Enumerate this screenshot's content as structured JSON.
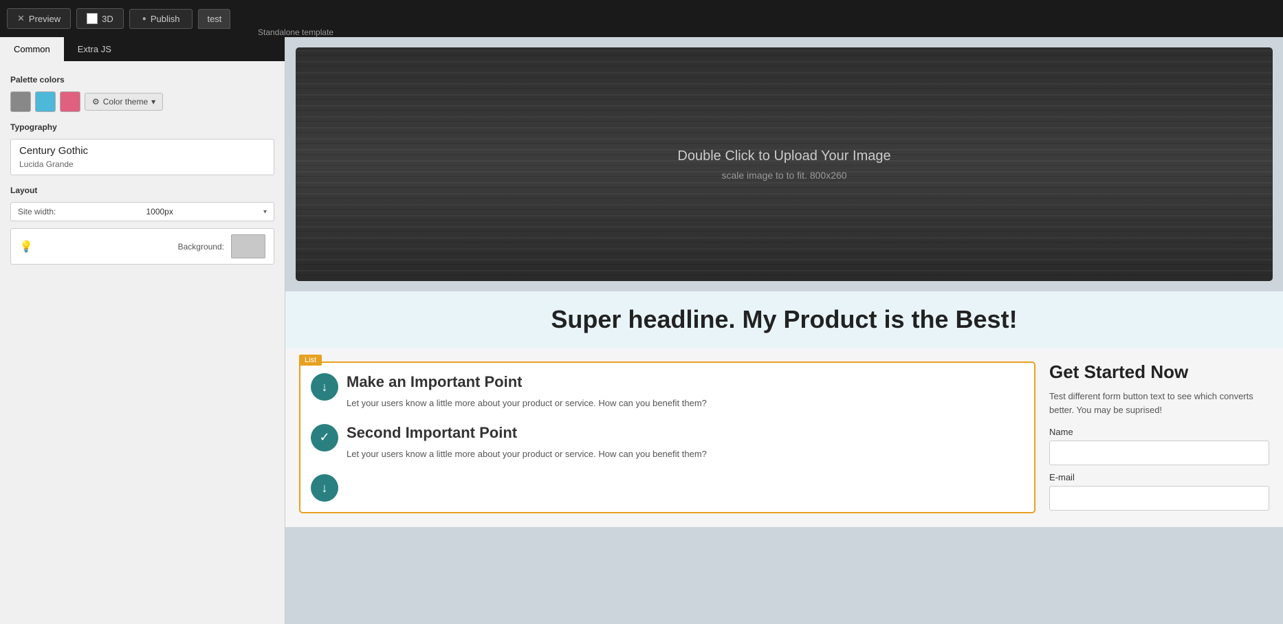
{
  "topbar": {
    "preview_label": "Preview",
    "preview_close": "✕",
    "threed_label": "3D",
    "publish_label": "Publish",
    "publish_icon": "●",
    "tab_test": "test",
    "standalone_label": "Standalone template"
  },
  "tabs": {
    "common": "Common",
    "extra_js": "Extra JS"
  },
  "panel": {
    "palette_label": "Palette colors",
    "colors": [
      "#888888",
      "#4db8d8",
      "#e06080"
    ],
    "color_theme_label": "Color theme",
    "typography_label": "Typography",
    "font_primary": "Century Gothic",
    "font_secondary": "Lucida Grande",
    "layout_label": "Layout",
    "site_width_label": "Site width:",
    "site_width_value": "1000px",
    "background_label": "Background:",
    "background_color": "#c8c8c8"
  },
  "canvas": {
    "hero_upload_text": "Double Click to Upload Your Image",
    "hero_scale_text": "scale image to to fit. 800x260",
    "headline": "Super headline. My Product is the Best!",
    "list_badge": "List",
    "list_item1_title": "Make an Important Point",
    "list_item1_desc": "Let your users know a little more about your product or service. How can you benefit them?",
    "list_item2_title": "Second Important Point",
    "list_item2_desc": "Let your users know a little more about your product or service. How can you benefit them?",
    "form_title": "Get Started Now",
    "form_subtitle": "Test different form button text to see which converts better. You may be suprised!",
    "form_name_label": "Name",
    "form_email_label": "E-mail"
  }
}
